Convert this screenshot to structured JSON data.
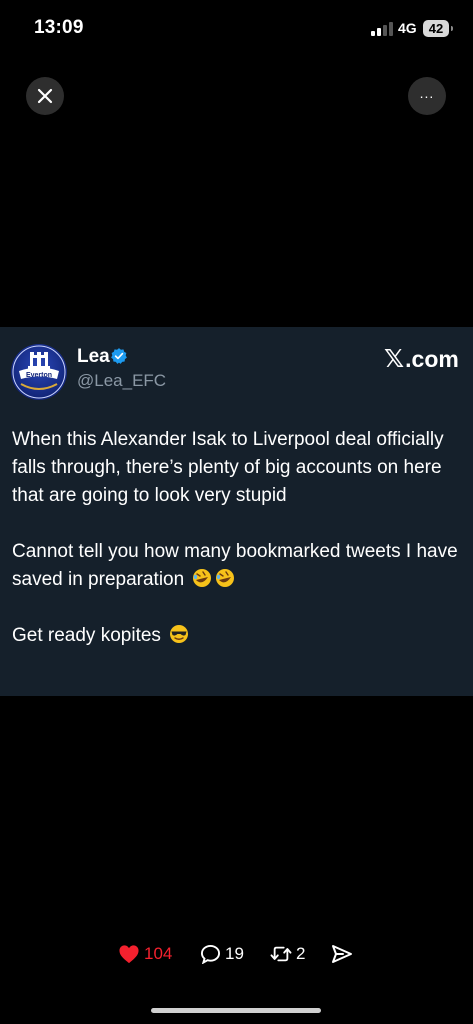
{
  "status_bar": {
    "time": "13:09",
    "network": "4G",
    "battery": "42"
  },
  "top_controls": {
    "close_icon": "close-icon",
    "more_icon": "more-icon",
    "more_label": "..."
  },
  "tweet": {
    "author_name": "Lea",
    "author_handle": "@Lea_EFC",
    "source_label": ".com",
    "avatar_text": "Everton",
    "paragraphs": [
      "When this Alexander Isak to Liverpool deal officially falls through, there’s plenty of big accounts on here that are going to look very stupid",
      "Cannot tell you how many bookmarked tweets I have saved in preparation",
      "Get ready kopites"
    ]
  },
  "actions": {
    "likes": "104",
    "replies": "19",
    "reposts": "2"
  },
  "colors": {
    "card_bg": "#15202b",
    "like": "#f4212e",
    "verified": "#1d9bf0",
    "handle": "#8b98a5"
  }
}
